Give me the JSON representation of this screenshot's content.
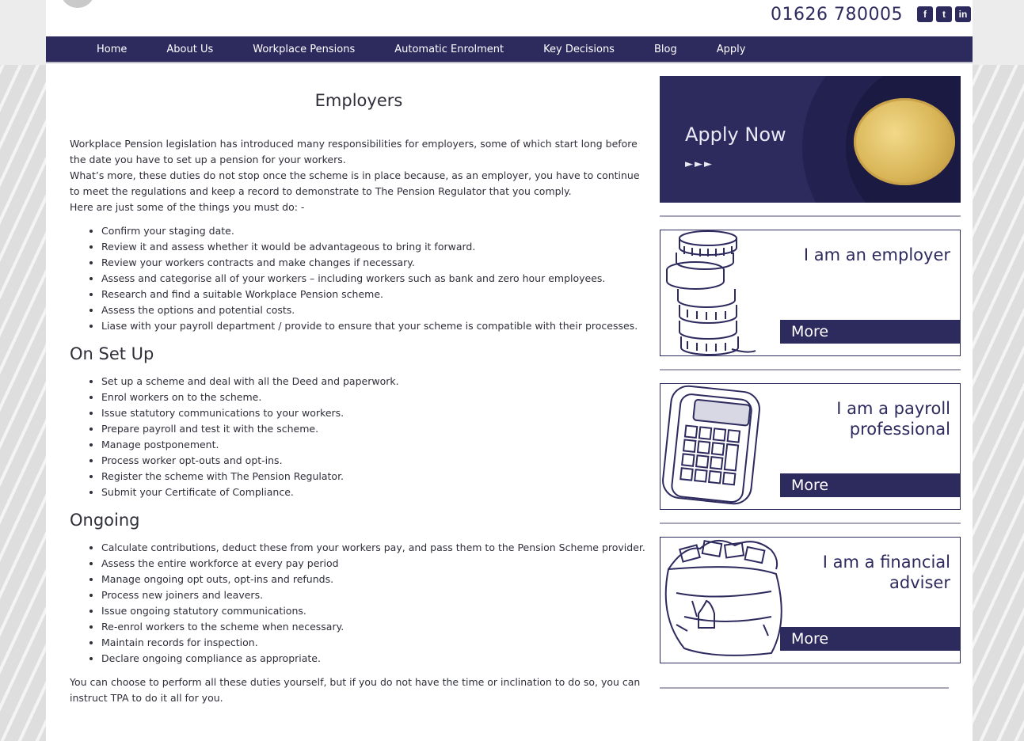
{
  "header": {
    "phone": "01626 780005",
    "social": [
      {
        "icon": "facebook-icon",
        "glyph": "f"
      },
      {
        "icon": "twitter-icon",
        "glyph": "t"
      },
      {
        "icon": "linkedin-icon",
        "glyph": "in"
      }
    ]
  },
  "nav": [
    "Home",
    "About Us",
    "Workplace Pensions",
    "Automatic Enrolment",
    "Key Decisions",
    "Blog",
    "Apply"
  ],
  "main": {
    "title": "Employers",
    "intro": [
      "Workplace Pension legislation has introduced many responsibilities for employers, some of which start long before the date you have to set up a pension for your workers.",
      "What’s more, these duties do not stop once the scheme is in place because, as an employer, you have to continue to meet the regulations and keep a record to demonstrate to The Pension Regulator that you comply.",
      "Here are just some of the things you must do: -"
    ],
    "before_list": [
      "Confirm your staging date.",
      "Review it and assess whether it would be advantageous to bring it forward.",
      "Review your workers contracts and make changes if necessary.",
      "Assess and categorise all of your workers – including workers such as bank and zero hour employees.",
      "Research and find a suitable Workplace Pension scheme.",
      "Assess the options and potential costs.",
      "Liase with your payroll department / provide to ensure that your scheme is compatible with their processes."
    ],
    "setup_heading": "On Set Up",
    "setup_list": [
      "Set up a scheme and deal with all the Deed and paperwork.",
      "Enrol workers on to the scheme.",
      "Issue statutory communications to your workers.",
      "Prepare payroll and test it with the scheme.",
      "Manage postponement.",
      "Process worker opt-outs and opt-ins.",
      "Register the scheme with The Pension Regulator.",
      "Submit your Certificate of Compliance."
    ],
    "ongoing_heading": "Ongoing",
    "ongoing_list": [
      "Calculate contributions, deduct these from your workers pay, and pass them to the Pension Scheme provider.",
      "Assess the entire workforce at every pay period",
      "Manage ongoing opt outs, opt-ins and refunds.",
      "Process new joiners and leavers.",
      "Issue ongoing statutory communications.",
      "Re-enrol workers to the scheme when necessary.",
      "Maintain records for inspection.",
      "Declare ongoing compliance as appropriate."
    ],
    "closing": "You can choose to perform all these duties yourself, but if you do not have the time or inclination to do so, you can instruct TPA to do it all for you."
  },
  "sidebar": {
    "apply_label": "Apply Now",
    "apply_arrows": "►►►",
    "cards": [
      {
        "title_lines": [
          "I am an employer"
        ],
        "more": "More",
        "icon": "coin-stack-icon"
      },
      {
        "title_lines": [
          "I am a payroll",
          "professional"
        ],
        "more": "More",
        "icon": "calculator-icon"
      },
      {
        "title_lines": [
          "I am a financial",
          "adviser"
        ],
        "more": "More",
        "icon": "money-bag-icon"
      }
    ]
  }
}
